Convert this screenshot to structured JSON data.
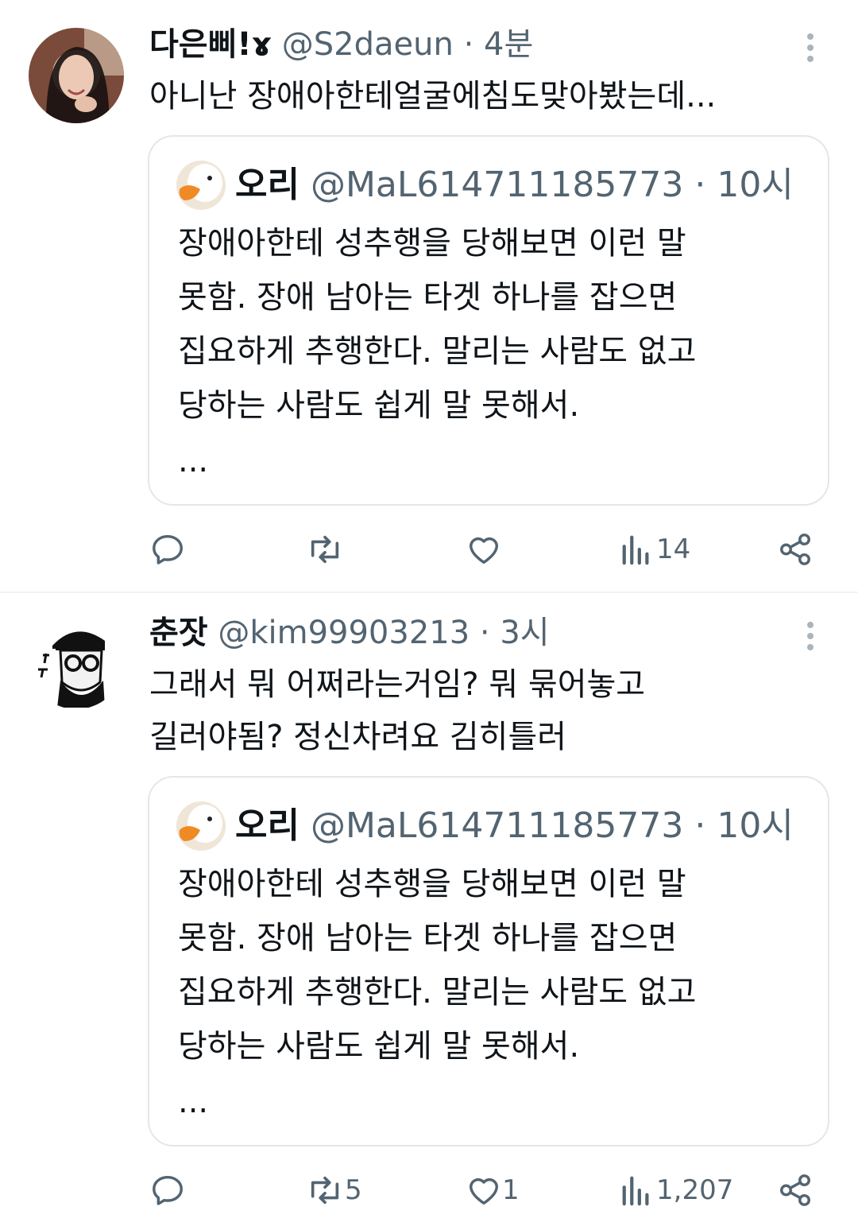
{
  "tweets": [
    {
      "name": "다은삐!ɤ",
      "handle": "@S2daeun",
      "separator": "·",
      "time": "4분",
      "text": "아니난 장애아한테얼굴에침도맞아봤는데...",
      "quote": {
        "name": "오리",
        "handle": "@MaL614711185773",
        "separator": "·",
        "time": "10시",
        "text": "장애아한테 성추행을 당해보면 이런 말\n못함. 장애 남아는 타겟 하나를 잡으면\n집요하게 추행한다. 말리는 사람도 없고\n당하는 사람도 쉽게 말 못해서.",
        "more": "..."
      },
      "actions": {
        "reply_count": "",
        "retweet_count": "",
        "like_count": "",
        "views": "14"
      }
    },
    {
      "name": "춘잣",
      "handle": "@kim99903213",
      "separator": "·",
      "time": "3시",
      "text": "그래서 뭐 어쩌라는거임? 뭐 묶어놓고\n길러야됨? 정신차려요 김히틀러",
      "quote": {
        "name": "오리",
        "handle": "@MaL614711185773",
        "separator": "·",
        "time": "10시",
        "text": "장애아한테 성추행을 당해보면 이런 말\n못함. 장애 남아는 타겟 하나를 잡으면\n집요하게 추행한다. 말리는 사람도 없고\n당하는 사람도 쉽게 말 못해서.",
        "more": "..."
      },
      "actions": {
        "reply_count": "",
        "retweet_count": "5",
        "like_count": "1",
        "views": "1,207"
      }
    }
  ],
  "icons": {
    "reply": "reply-icon",
    "retweet": "retweet-icon",
    "like": "heart-icon",
    "views": "views-icon",
    "share": "share-icon",
    "more": "more-icon"
  },
  "colors": {
    "text": "#0f1419",
    "muted": "#536471",
    "border": "#e2e7eb"
  }
}
